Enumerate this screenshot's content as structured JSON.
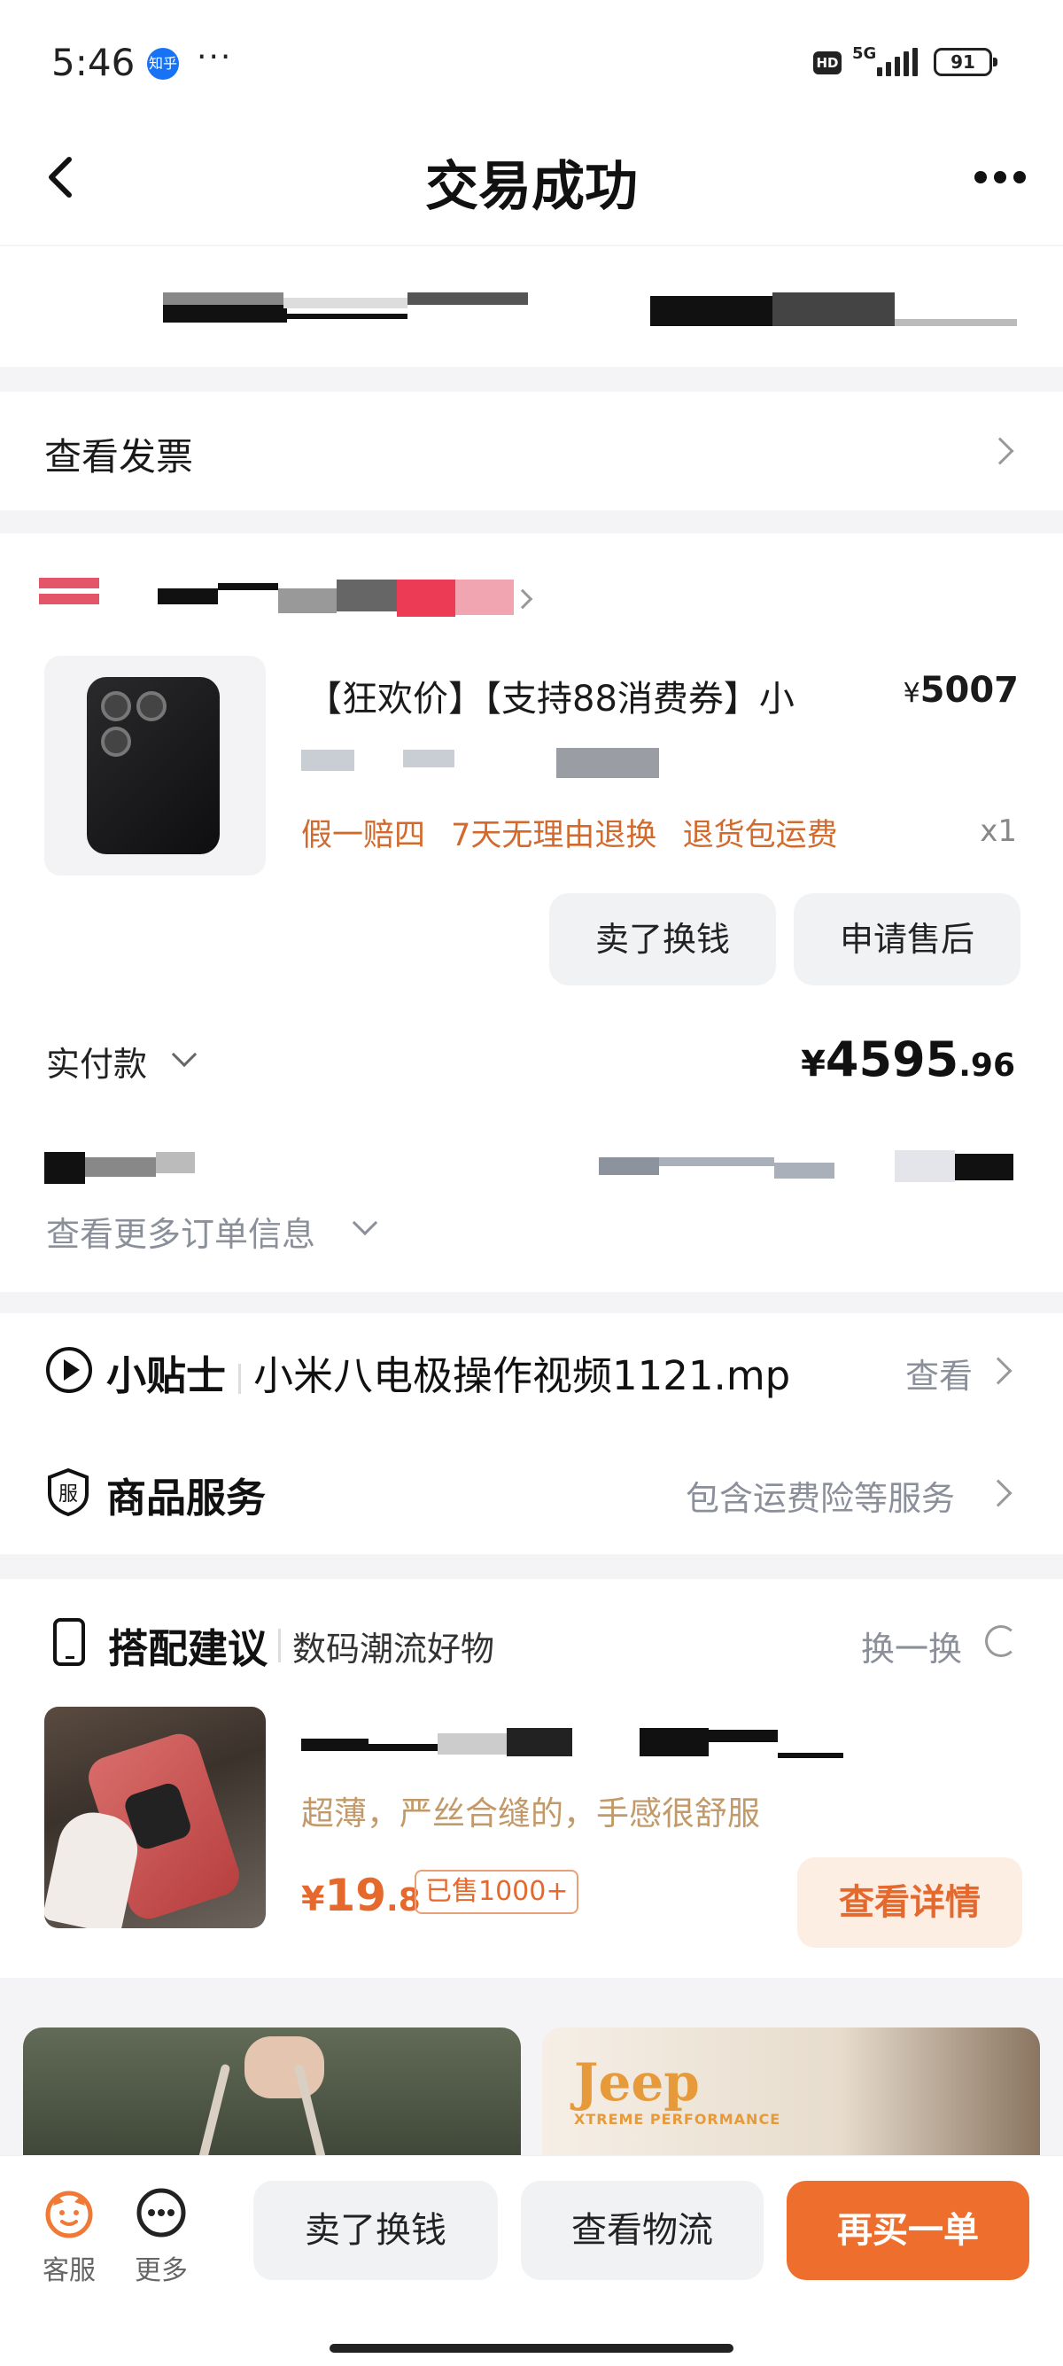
{
  "status_bar": {
    "time": "5:46",
    "app_badge": "知乎",
    "dots": "···",
    "hd": "HD",
    "network": "5G",
    "battery": "91"
  },
  "header": {
    "title": "交易成功"
  },
  "invoice": {
    "label": "查看发票"
  },
  "product": {
    "title": "【狂欢价】【支持88消费券】小",
    "price_symbol": "¥",
    "price": "5007",
    "tags": [
      "假一赔四",
      "7天无理由退换",
      "退货包运费"
    ],
    "quantity": "x1",
    "btn_sell": "卖了换钱",
    "btn_aftersale": "申请售后"
  },
  "payment": {
    "label": "实付款",
    "symbol": "¥",
    "amount_int": "4595",
    "amount_dec": ".96"
  },
  "more_order_info": "查看更多订单信息",
  "tips": {
    "label": "小贴士",
    "file": "小米八电极操作视频1121.mp",
    "link": "查看"
  },
  "service": {
    "label": "商品服务",
    "link": "包含运费险等服务",
    "icon_char": "服"
  },
  "suggestion": {
    "title": "搭配建议",
    "subtitle": "数码潮流好物",
    "refresh": "换一换",
    "item": {
      "desc": "超薄，严丝合缝的，手感很舒服",
      "price_symbol": "¥",
      "price_int": "19",
      "price_dec": ".8",
      "sold": "已售1000+",
      "btn": "查看详情"
    }
  },
  "recommend": {
    "brand": "Jeep",
    "brand_sub": "XTREME PERFORMANCE"
  },
  "bottom_bar": {
    "service": "客服",
    "more": "更多",
    "btn_sell": "卖了换钱",
    "btn_logistics": "查看物流",
    "btn_rebuy": "再买一单"
  },
  "colors": {
    "accent": "#ee6f2d",
    "tag": "#d26a2e",
    "muted": "#8a8f9a"
  }
}
